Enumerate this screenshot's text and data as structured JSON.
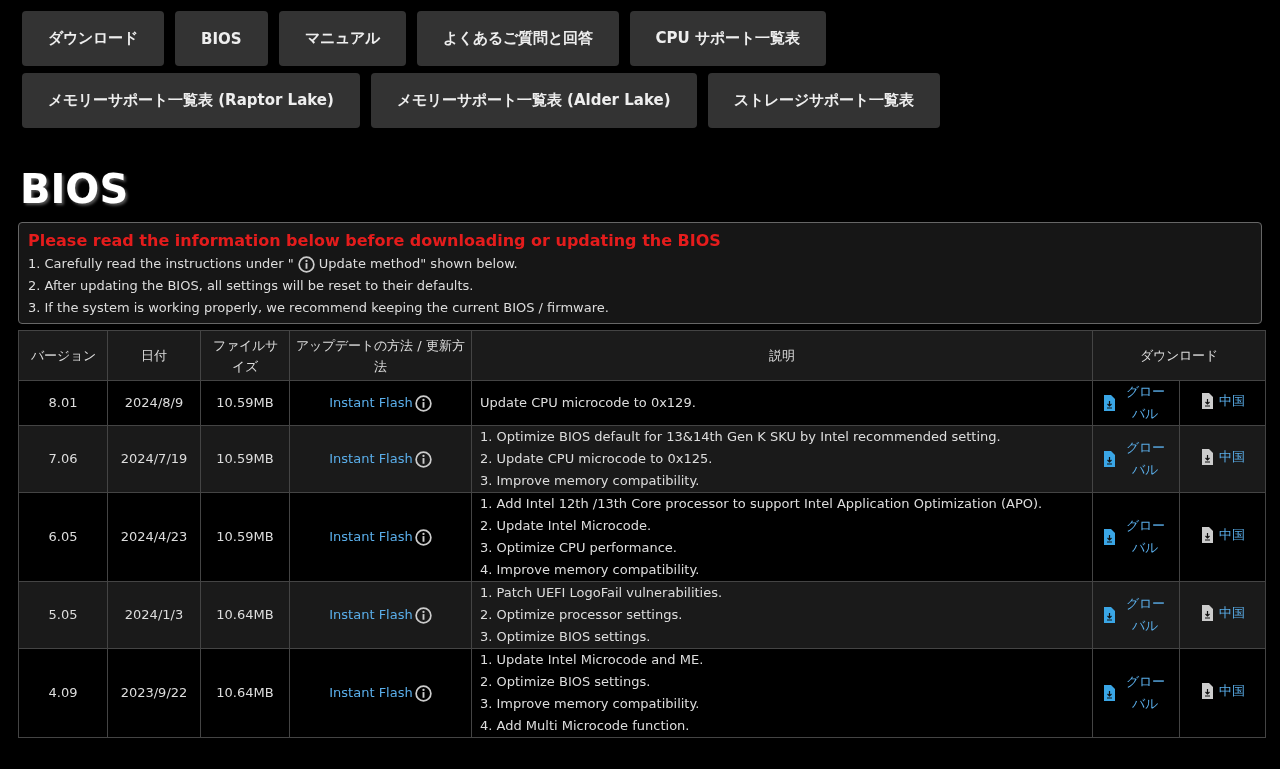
{
  "nav_buttons": [
    [
      "ダウンロード",
      "BIOS",
      "マニュアル",
      "よくあるご質問と回答",
      "CPU サポート一覧表"
    ],
    [
      "メモリーサポート一覧表 (Raptor Lake)",
      "メモリーサポート一覧表 (Alder Lake)",
      "ストレージサポート一覧表"
    ]
  ],
  "heading": "BIOS",
  "notice": {
    "title": "Please read the information below before downloading or updating the BIOS",
    "lines": [
      {
        "before": "1. Carefully read the instructions under \"",
        "after": "Update method\" shown below."
      },
      {
        "before": "2. After updating the BIOS, all settings will be reset to their defaults."
      },
      {
        "before": "3. If the system is working properly, we recommend keeping the current BIOS / firmware."
      }
    ]
  },
  "table": {
    "columns": [
      "バージョン",
      "日付",
      "ファイルサイズ",
      "アップデートの方法 / 更新方法",
      "説明",
      "ダウンロード"
    ],
    "rows": [
      {
        "version": "8.01",
        "date": "2024/8/9",
        "size": "10.59MB",
        "method": "Instant Flash",
        "description": [
          "Update CPU microcode to 0x129."
        ],
        "downloads": [
          {
            "kind": "global",
            "label": "グローバル"
          },
          {
            "kind": "china",
            "label": "中国"
          }
        ]
      },
      {
        "version": "7.06",
        "date": "2024/7/19",
        "size": "10.59MB",
        "method": "Instant Flash",
        "description": [
          "1. Optimize BIOS default for 13&14th Gen K SKU by Intel recommended setting.",
          "2. Update CPU microcode to 0x125.",
          "3. Improve memory compatibility."
        ],
        "downloads": [
          {
            "kind": "global",
            "label": "グローバル"
          },
          {
            "kind": "china",
            "label": "中国"
          }
        ]
      },
      {
        "version": "6.05",
        "date": "2024/4/23",
        "size": "10.59MB",
        "method": "Instant Flash",
        "description": [
          "1. Add Intel 12th /13th Core processor to support Intel Application Optimization (APO).",
          "2. Update Intel Microcode.",
          "3. Optimize CPU performance.",
          "4. Improve memory compatibility."
        ],
        "downloads": [
          {
            "kind": "global",
            "label": "グローバル"
          },
          {
            "kind": "china",
            "label": "中国"
          }
        ]
      },
      {
        "version": "5.05",
        "date": "2024/1/3",
        "size": "10.64MB",
        "method": "Instant Flash",
        "description": [
          "1. Patch UEFI LogoFail vulnerabilities.",
          "2. Optimize processor settings.",
          "3. Optimize BIOS settings."
        ],
        "downloads": [
          {
            "kind": "global",
            "label": "グローバル"
          },
          {
            "kind": "china",
            "label": "中国"
          }
        ]
      },
      {
        "version": "4.09",
        "date": "2023/9/22",
        "size": "10.64MB",
        "method": "Instant Flash",
        "description": [
          "1. Update Intel Microcode and ME.",
          "2. Optimize BIOS settings.",
          "3. Improve memory compatibility.",
          "4. Add Multi Microcode function."
        ],
        "downloads": [
          {
            "kind": "global",
            "label": "グローバル"
          },
          {
            "kind": "china",
            "label": "中国"
          }
        ]
      }
    ]
  }
}
